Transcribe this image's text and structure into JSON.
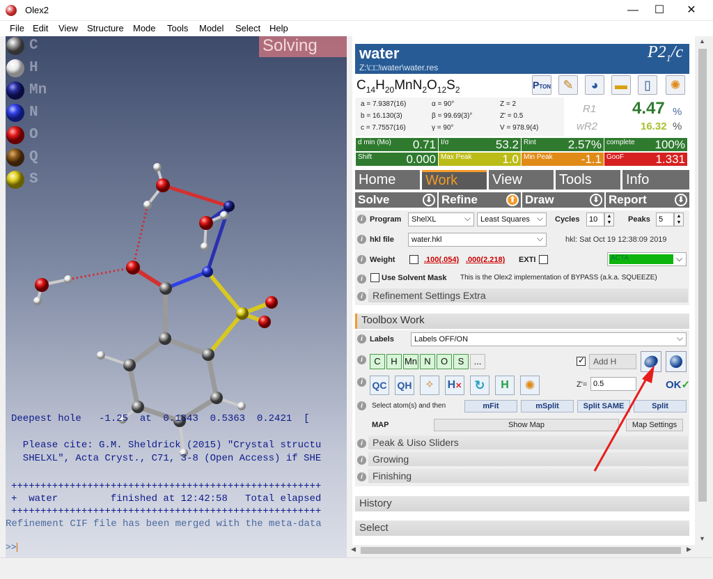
{
  "window": {
    "title": "Olex2",
    "minimize": "—",
    "maximize": "☐",
    "close": "✕"
  },
  "menu": [
    "File",
    "Edit",
    "View",
    "Structure",
    "Mode",
    "Tools",
    "Model",
    "Select",
    "Help"
  ],
  "legend": [
    "C",
    "H",
    "Mn",
    "N",
    "O",
    "Q",
    "S"
  ],
  "colors": {
    "C": "#888888",
    "H": "#f2f2f2",
    "Mn": "#262a96",
    "N": "#3040e8",
    "O": "#e01818",
    "Q": "#8a5a1a",
    "S": "#e0d020",
    "accent": "#f39a2a",
    "header": "#275b95"
  },
  "viewport": {
    "status": "Solving"
  },
  "console": {
    "lines": [
      "Deepest hole   -1.25  at  0.1843  0.5363  0.2421  [",
      "  Please cite: G.M. Sheldrick (2015) \"Crystal structu",
      "  SHELXL\", Acta Cryst., C71, 3-8 (Open Access) if SHE",
      "+++++++++++++++++++++++++++++++++++++++++++++++++++++",
      "+  water         finished at 12:42:58   Total elapsed",
      "+++++++++++++++++++++++++++++++++++++++++++++++++++++"
    ],
    "merged": "Refinement CIF file has been merged with the meta-data",
    "prompt": ">>"
  },
  "header": {
    "name": "water",
    "path": "Z:\\□□\\water\\water.res",
    "space_group": "P21/c"
  },
  "formula": "C14H20MnN2O12S2",
  "cell": {
    "a": "a = 7.9387(16)",
    "b": "b = 16.130(3)",
    "c": "c = 7.7557(16)",
    "alpha": "α = 90°",
    "beta": "β = 99.69(3)°",
    "gamma": "γ = 90°",
    "Z": "Z = 2",
    "Zp": "Z' = 0.5",
    "V": "V = 978.9(4)"
  },
  "r": {
    "r1_label": "R1",
    "r1": "4.47",
    "wr2_label": "wR2",
    "wr2": "16.32",
    "pct": "%"
  },
  "stats": [
    {
      "label": "d min (Mo)",
      "value": "0.71",
      "color": "#2f7a2f"
    },
    {
      "label": "I/σ",
      "value": "53.2",
      "color": "#2f7a2f"
    },
    {
      "label": "Rint",
      "value": "2.57%",
      "color": "#2f7a2f"
    },
    {
      "label": "complete",
      "value": "100%",
      "color": "#2f7a2f"
    },
    {
      "label": "Shift",
      "value": "0.000",
      "color": "#2f7a2f"
    },
    {
      "label": "Max Peak",
      "value": "1.0",
      "color": "#bcbc18"
    },
    {
      "label": "Min Peak",
      "value": "-1.1",
      "color": "#e08a18"
    },
    {
      "label": "GooF",
      "value": "1.331",
      "color": "#d62020"
    }
  ],
  "tabs": [
    "Home",
    "Work",
    "View",
    "Tools",
    "Info"
  ],
  "subtabs": [
    "Solve",
    "Refine",
    "Draw",
    "Report"
  ],
  "refine": {
    "program_label": "Program",
    "program": "ShelXL",
    "method": "Least Squares",
    "cycles_label": "Cycles",
    "cycles": "10",
    "peaks_label": "Peaks",
    "peaks": "5",
    "hkl_label": "hkl file",
    "hkl": "water.hkl",
    "hkl_date": "hkl: Sat Oct 19 12:38:09 2019",
    "weight_label": "Weight",
    "w1": ".100(.054)",
    "w2": ".000(2.218)",
    "exti": "EXTI",
    "acta": "ACTA",
    "mask_label": "Use Solvent Mask",
    "mask_note": "This is the Olex2 implementation of BYPASS (a.k.a. SQUEEZE)",
    "extra": "Refinement Settings Extra"
  },
  "toolbox": {
    "title": "Toolbox Work",
    "labels_label": "Labels",
    "labels_value": "Labels OFF/ON",
    "elements": [
      "C",
      "H",
      "Mn",
      "N",
      "O",
      "S",
      "..."
    ],
    "addh": "Add H",
    "zprime_label": "Z'=",
    "zprime": "0.5",
    "select_text": "Select atom(s) and then",
    "mfit": "mFit",
    "msplit": "mSplit",
    "splitsame": "Split SAME",
    "split": "Split",
    "map_label": "MAP",
    "show_map": "Show Map",
    "map_settings": "Map Settings",
    "peak": "Peak & Uiso Sliders",
    "growing": "Growing",
    "finishing": "Finishing"
  },
  "sections": {
    "history": "History",
    "select": "Select"
  }
}
